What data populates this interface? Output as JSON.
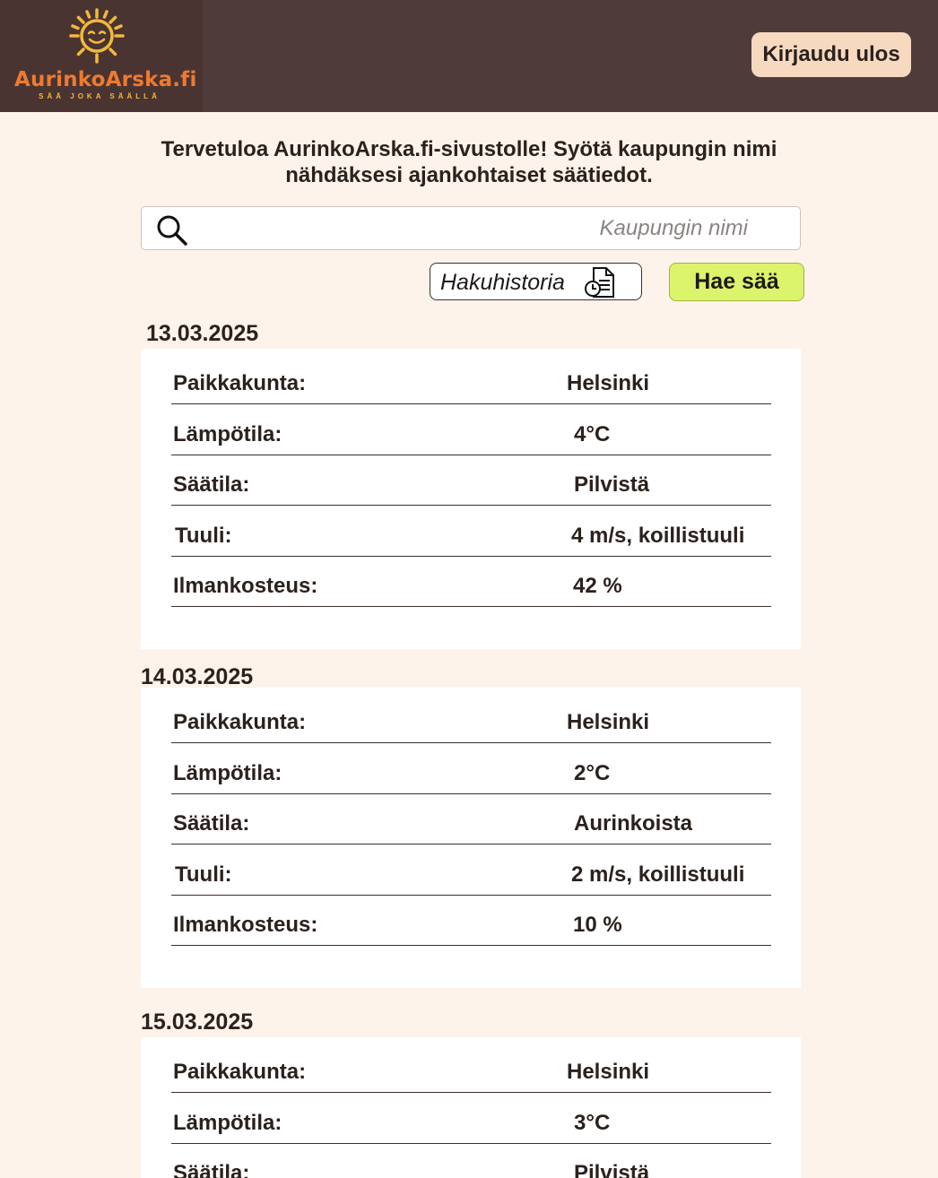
{
  "header": {
    "logo_text": "AurinkoArska.fi",
    "logo_tagline": "SÄÄ JOKA SÄÄLLÄ",
    "logout_label": "Kirjaudu ulos"
  },
  "intro_text": "Tervetuloa AurinkoArska.fi-sivustolle! Syötä kaupungin nimi nähdäksesi ajankohtaiset säätiedot.",
  "search": {
    "placeholder": "Kaupungin nimi",
    "value": ""
  },
  "history_label": "Hakuhistoria",
  "search_button_label": "Hae sää",
  "colors": {
    "header_bg": "#4f3c3a",
    "page_bg": "#fdf3ea",
    "logout_bg": "#f6d9bf",
    "search_btn_bg": "#dcf36c",
    "logo_orange": "#ef7a2f",
    "logo_yellow": "#f2b93a"
  },
  "forecasts": [
    {
      "date": "13.03.2025",
      "rows": [
        {
          "label": "Paikkakunta:",
          "value": "Helsinki"
        },
        {
          "label": "Lämpötila:",
          "value": "4°C"
        },
        {
          "label": "Säätila:",
          "value": "Pilvistä"
        },
        {
          "label": "Tuuli:",
          "value": "4 m/s, koillistuuli"
        },
        {
          "label": "Ilmankosteus:",
          "value": "42 %"
        }
      ]
    },
    {
      "date": "14.03.2025",
      "rows": [
        {
          "label": "Paikkakunta:",
          "value": "Helsinki"
        },
        {
          "label": "Lämpötila:",
          "value": "2°C"
        },
        {
          "label": "Säätila:",
          "value": "Aurinkoista"
        },
        {
          "label": "Tuuli:",
          "value": "2 m/s, koillistuuli"
        },
        {
          "label": "Ilmankosteus:",
          "value": "10 %"
        }
      ]
    },
    {
      "date": "15.03.2025",
      "rows": [
        {
          "label": "Paikkakunta:",
          "value": "Helsinki"
        },
        {
          "label": "Lämpötila:",
          "value": "3°C"
        },
        {
          "label": "Säätila:",
          "value": "Pilvistä"
        }
      ]
    }
  ]
}
